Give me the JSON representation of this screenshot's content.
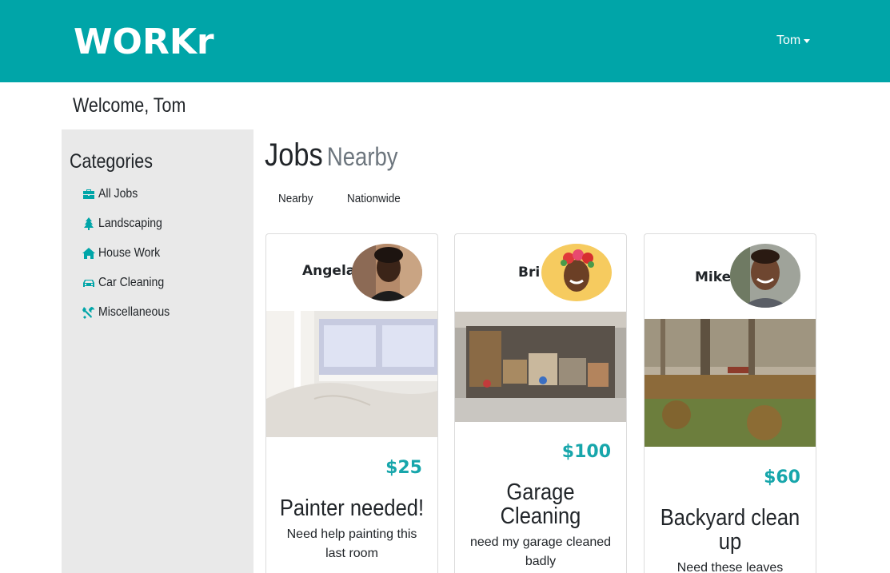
{
  "app": {
    "brand": "WORKr",
    "user": "Tom"
  },
  "welcome": "Welcome, Tom",
  "sidebar": {
    "title": "Categories",
    "items": [
      {
        "label": "All Jobs",
        "icon": "toolbox-icon"
      },
      {
        "label": "Landscaping",
        "icon": "tree-icon"
      },
      {
        "label": "House Work",
        "icon": "home-icon"
      },
      {
        "label": "Car Cleaning",
        "icon": "car-icon"
      },
      {
        "label": "Miscellaneous",
        "icon": "tools-icon"
      }
    ]
  },
  "main": {
    "title": "Jobs",
    "subtitle": "Nearby",
    "tabs": [
      {
        "label": "Nearby"
      },
      {
        "label": "Nationwide"
      }
    ]
  },
  "jobs": [
    {
      "name": "Angela",
      "price": "$25",
      "title": "Painter needed!",
      "description": "Need help painting this last room"
    },
    {
      "name": "Bri",
      "price": "$100",
      "title": "Garage Cleaning",
      "description": "need my garage cleaned badly"
    },
    {
      "name": "Mike",
      "price": "$60",
      "title": "Backyard clean up",
      "description": "Need these leaves"
    }
  ],
  "colors": {
    "accent": "#00a5a8",
    "price": "#17a6ab",
    "sidebar": "#e9e9e9"
  }
}
